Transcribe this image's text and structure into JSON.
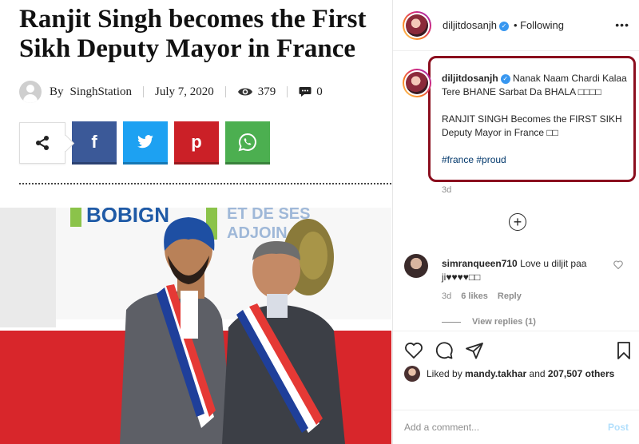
{
  "article": {
    "headline": "Ranjit Singh becomes the First Sikh Deputy Mayor in France",
    "by_label": "By",
    "author": "SinghStation",
    "date": "July 7, 2020",
    "views": "379",
    "comments": "0",
    "share": {
      "facebook_glyph": "f",
      "twitter_icon": "twitter-icon",
      "pinterest_glyph": "p",
      "whatsapp_icon": "whatsapp-icon"
    },
    "photo": {
      "banner_left": "BOBIGN",
      "banner_right_1": "ET DE SES",
      "banner_right_2": "ADJOIN"
    }
  },
  "instagram": {
    "username": "diljitdosanjh",
    "following_label": "• Following",
    "caption": {
      "username": "diljitdosanjh",
      "line1": "Nanak Naam Chardi Kalaa Tere BHANE Sarbat Da BHALA □□□□",
      "line2": "RANJIT SINGH Becomes the FIRST SIKH Deputy Mayor in France □□",
      "hashtags": "#france #proud",
      "time": "3d"
    },
    "comment": {
      "username": "simranqueen710",
      "text": "Love u diljit paa ji♥♥♥♥□□",
      "time": "3d",
      "likes": "6 likes",
      "reply": "Reply",
      "view_replies": "View replies (1)"
    },
    "likes": {
      "prefix": "Liked by",
      "user": "mandy.takhar",
      "middle": "and",
      "count": "207,507 others"
    },
    "comment_bar": {
      "placeholder": "Add a comment...",
      "post": "Post"
    },
    "colors": {
      "highlight_border": "#8b0e1e",
      "link": "#00376b",
      "verified": "#3897f0"
    }
  }
}
